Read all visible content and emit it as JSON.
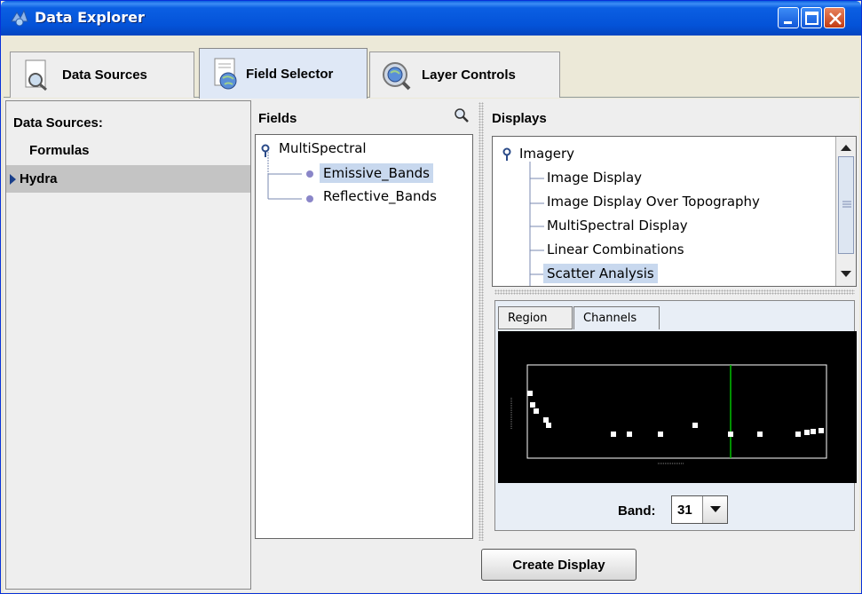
{
  "window": {
    "title": "Data Explorer"
  },
  "tabs": [
    {
      "label": "Data Sources",
      "icon": "magnifier-doc-icon"
    },
    {
      "label": "Field Selector",
      "icon": "globe-doc-icon",
      "active": true
    },
    {
      "label": "Layer Controls",
      "icon": "globe-magnifier-icon"
    }
  ],
  "data_sources": {
    "header": "Data Sources:",
    "items": [
      "Formulas",
      "Hydra"
    ],
    "selected": "Hydra"
  },
  "fields": {
    "header": "Fields",
    "root": "MultiSpectral",
    "children": [
      "Emissive_Bands",
      "Reflective_Bands"
    ],
    "selected": "Emissive_Bands"
  },
  "displays": {
    "header": "Displays",
    "root": "Imagery",
    "items": [
      "Image Display",
      "Image Display Over Topography",
      "MultiSpectral Display",
      "Linear Combinations",
      "Scatter Analysis"
    ],
    "selected": "Scatter Analysis"
  },
  "subtabs": [
    {
      "label": "Region"
    },
    {
      "label": "Channels",
      "active": true
    }
  ],
  "band": {
    "label": "Band:",
    "value": "31"
  },
  "buttons": {
    "create_display": "Create Display"
  },
  "colors": {
    "title_bar": "#0453d8",
    "selection": "#c8d8ee",
    "plot_bg": "#000000",
    "plot_marker": "#ffffff",
    "band_line": "#00c000"
  }
}
